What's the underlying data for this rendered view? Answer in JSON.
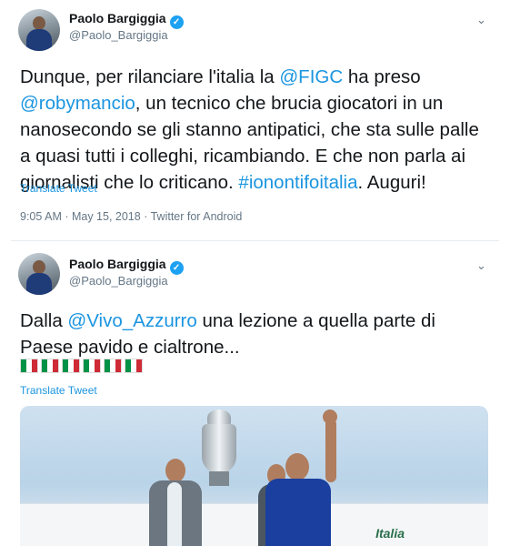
{
  "tweets": [
    {
      "author_name": "Paolo Bargiggia",
      "handle": "@Paolo_Bargiggia",
      "text": {
        "l1_a": "Dunque, per rilanciare l'italia la ",
        "l1_link": "@FIGC",
        "l1_b": " ha preso",
        "l2_link": "@robymancio",
        "l2_b": ", un tecnico che brucia giocatori in un",
        "l3": "nanosecondo se gli stanno antipatici, che sta sulle palle",
        "l4": "a quasi tutti i colleghi, ricambiando. E che non parla ai",
        "l5_a": "giornalisti che lo criticano. ",
        "l5_link": "#ionontifoitalia",
        "l5_b": ". Auguri!"
      },
      "translate_label": "Translate Tweet",
      "meta": "9:05 AM · May 15, 2018 · Twitter for Android"
    },
    {
      "author_name": "Paolo Bargiggia",
      "handle": "@Paolo_Bargiggia",
      "text": {
        "l1_a": "Dalla ",
        "l1_link": "@Vivo_Azzurro",
        "l1_b": " una lezione a quella parte di",
        "l2": "Paese pavido e cialtrone..."
      },
      "flags": [
        "🇮🇹",
        "🇮🇹",
        "🇮🇹",
        "🇮🇹",
        "🇮🇹",
        "🇮🇹"
      ],
      "translate_label": "Translate Tweet",
      "media": {
        "airline_text": "Italia"
      }
    }
  ],
  "icons": {
    "verified": "verified-badge-icon",
    "more": "chevron-down-icon"
  },
  "colors": {
    "link": "#1b95e0",
    "verified": "#1da1f2",
    "secondary_text": "#657786"
  }
}
